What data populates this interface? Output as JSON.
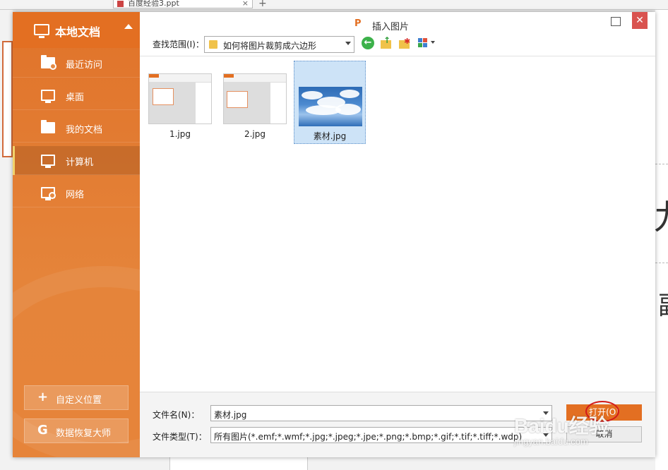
{
  "background": {
    "tab_title": "百度经验3.ppt",
    "glyph_1": "九",
    "glyph_2": "副"
  },
  "sidebar": {
    "header_label": "本地文档",
    "items": [
      {
        "label": "最近访问",
        "icon": "recent-folder-icon"
      },
      {
        "label": "桌面",
        "icon": "desktop-icon"
      },
      {
        "label": "我的文档",
        "icon": "folder-icon"
      },
      {
        "label": "计算机",
        "icon": "computer-icon",
        "active": true
      },
      {
        "label": "网络",
        "icon": "network-icon"
      }
    ],
    "custom_location_label": "自定义位置",
    "data_recovery_label": "数据恢复大师"
  },
  "dialog": {
    "title": "插入图片",
    "title_icon_glyph": "P",
    "close_glyph": "✕"
  },
  "toolbar": {
    "lookin_label": "查找范围(I)：",
    "lookin_value": "如何将图片裁剪成六边形",
    "back_glyph": "←",
    "up_glyph": "↑",
    "new_glyph": "✱"
  },
  "files": [
    {
      "name": "1.jpg",
      "selected": false
    },
    {
      "name": "2.jpg",
      "selected": false
    },
    {
      "name": "素材.jpg",
      "selected": true
    }
  ],
  "bottom": {
    "filename_label": "文件名(N)：",
    "filename_value": "素材.jpg",
    "filetype_label": "文件类型(T)：",
    "filetype_value": "所有图片(*.emf;*.wmf;*.jpg;*.jpeg;*.jpe;*.png;*.bmp;*.gif;*.tif;*.tiff;*.wdp)",
    "open_label": "打开(O)",
    "cancel_label": "取消"
  },
  "watermark": {
    "main": "Baidu经验",
    "sub": "jingyan.baidu.com"
  },
  "colors": {
    "accent": "#e36f22",
    "close_red": "#d9534f",
    "selection": "#cde3f7",
    "annotation_ring": "#d21b1b"
  }
}
